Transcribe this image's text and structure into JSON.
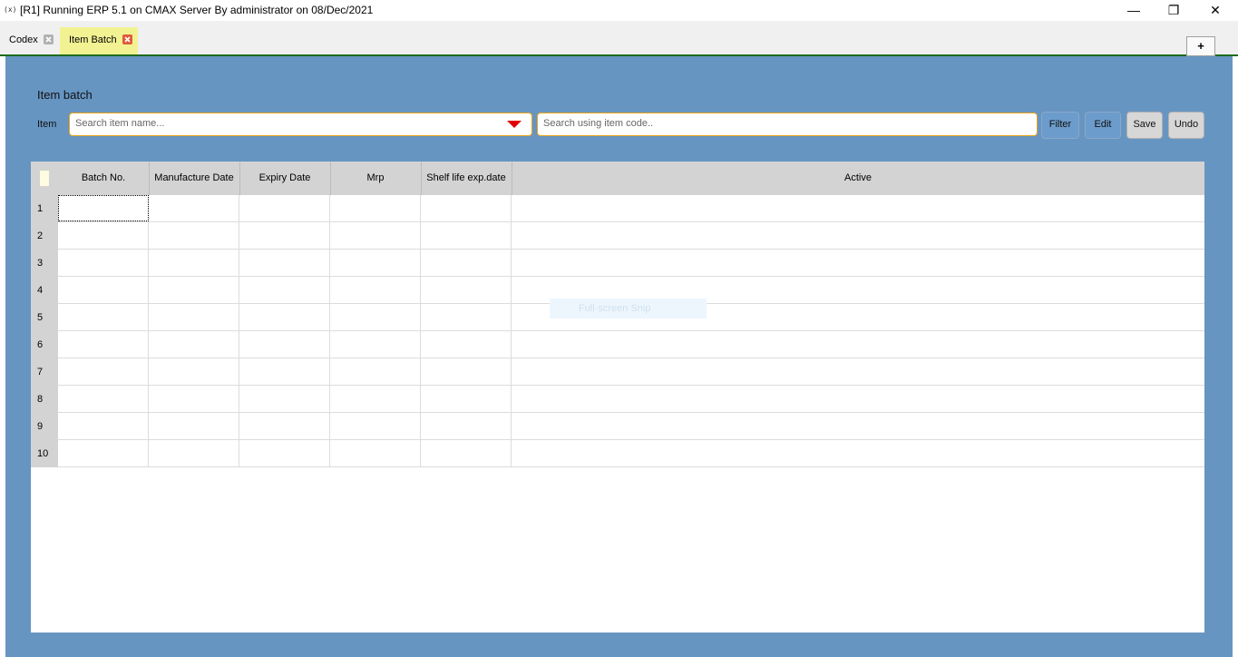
{
  "window": {
    "app_icon": "(x)",
    "title": "[R1] Running ERP 5.1 on CMAX Server By administrator on 08/Dec/2021",
    "minimize_glyph": "—",
    "restore_glyph": "❐",
    "close_glyph": "✕"
  },
  "tabs": [
    {
      "label": "Codex",
      "close_color": "#b0b0b0"
    },
    {
      "label": "Item Batch",
      "close_color": "#e05a3a"
    }
  ],
  "add_tab_label": "+",
  "panel": {
    "title": "Item batch",
    "item_label": "Item",
    "search_name_placeholder": "Search item name...",
    "search_code_placeholder": "Search using item code..",
    "buttons": {
      "filter": "Filter",
      "edit": "Edit",
      "save": "Save",
      "undo": "Undo"
    }
  },
  "grid": {
    "columns": [
      "Batch No.",
      "Manufacture Date",
      "Expiry Date",
      "Mrp",
      "Shelf life exp.date",
      "Active"
    ],
    "rows": [
      "1",
      "2",
      "3",
      "4",
      "5",
      "6",
      "7",
      "8",
      "9",
      "10"
    ]
  },
  "overlay": {
    "text": "Full-screen Snip"
  },
  "colors": {
    "panel_bg": "#6795c2",
    "active_tab": "#f2f293",
    "accent_border": "#e8a31a",
    "dropdown_arrow": "#e00000"
  }
}
